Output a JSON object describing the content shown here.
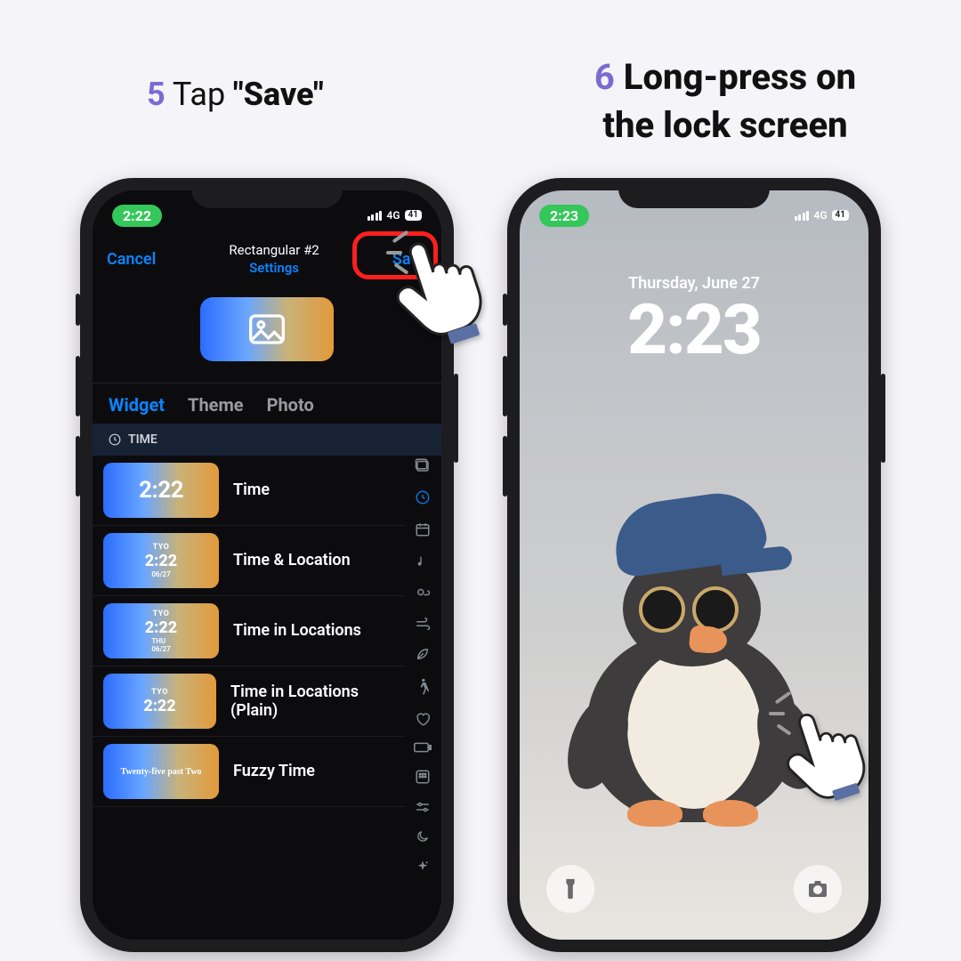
{
  "steps": {
    "s5": {
      "num": "5",
      "pre": "Tap ",
      "bold": "\"Save\""
    },
    "s6": {
      "num": "6",
      "line1": "Long-press on",
      "line2": "the lock screen"
    }
  },
  "status": {
    "time1": "2:22",
    "time2": "2:23",
    "net": "4G",
    "bat": "41"
  },
  "nav": {
    "cancel": "Cancel",
    "title": "Rectangular #2",
    "subtitle": "Settings",
    "save": "Save"
  },
  "tabs": {
    "widget": "Widget",
    "theme": "Theme",
    "photo": "Photo"
  },
  "section": "TIME",
  "widgets": [
    {
      "label": "Time",
      "big": "2:22"
    },
    {
      "label": "Time & Location",
      "t1": "TYO",
      "t2": "2:22",
      "t3": "06/27"
    },
    {
      "label": "Time in Locations",
      "t1": "TYO",
      "t2": "2:22",
      "t3": "THU\n06/27"
    },
    {
      "label": "Time in Locations (Plain)",
      "t1": "TYO",
      "t2": "2:22"
    },
    {
      "label": "Fuzzy Time",
      "fz": "Twenty-five past Two"
    }
  ],
  "lock": {
    "date": "Thursday, June 27",
    "time": "2:23"
  }
}
